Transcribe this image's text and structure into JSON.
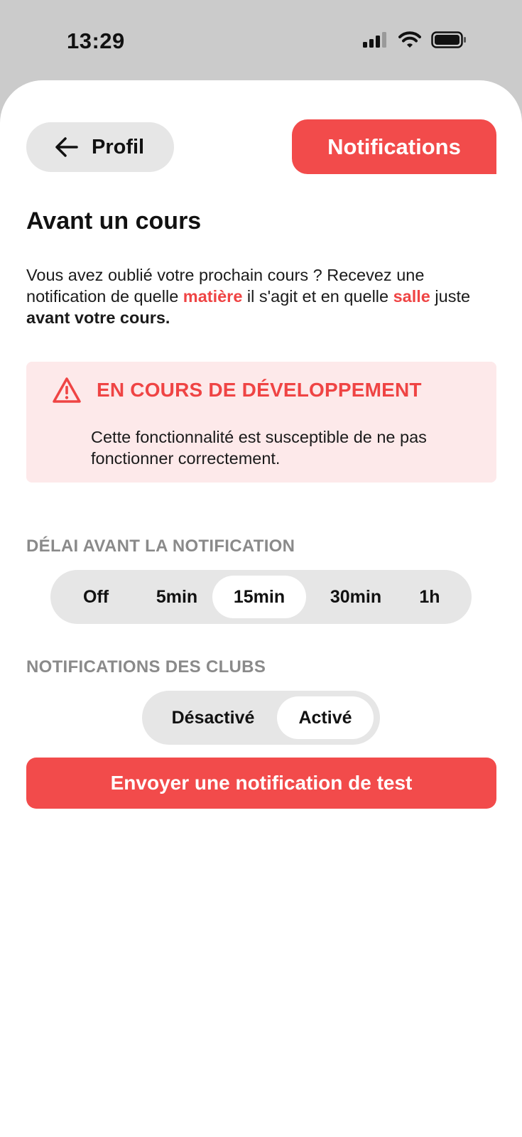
{
  "status_bar": {
    "time": "13:29",
    "icons": [
      "signal-icon",
      "wifi-icon",
      "battery-icon"
    ]
  },
  "header": {
    "back_label": "Profil",
    "back_icon": "arrow-left-icon",
    "active_tab": "Notifications"
  },
  "section": {
    "title": "Avant un cours",
    "description": {
      "part1": "Vous avez oublié votre prochain cours ? Recevez une notification de quelle ",
      "highlight1": "matière",
      "part2": " il s'agit et en quelle ",
      "highlight2": "salle",
      "part3": " juste ",
      "bold": "avant votre cours."
    }
  },
  "warning": {
    "icon": "warning-triangle-icon",
    "title": "EN COURS DE DÉVELOPPEMENT",
    "text": "Cette fonctionnalité est susceptible de ne pas fonctionner correctement."
  },
  "delay": {
    "caption": "DÉLAI AVANT LA NOTIFICATION",
    "options": [
      "Off",
      "5min",
      "15min",
      "30min",
      "1h"
    ],
    "selected": "15min"
  },
  "clubs": {
    "caption": "NOTIFICATIONS DES CLUBS",
    "options": [
      "Désactivé",
      "Activé"
    ],
    "selected": "Activé"
  },
  "test_button": {
    "label": "Envoyer une notification de test"
  },
  "colors": {
    "accent": "#f24b4b",
    "warning_bg": "#fde9ea",
    "segment_bg": "#e6e6e6",
    "caption": "#8a8a8a"
  }
}
